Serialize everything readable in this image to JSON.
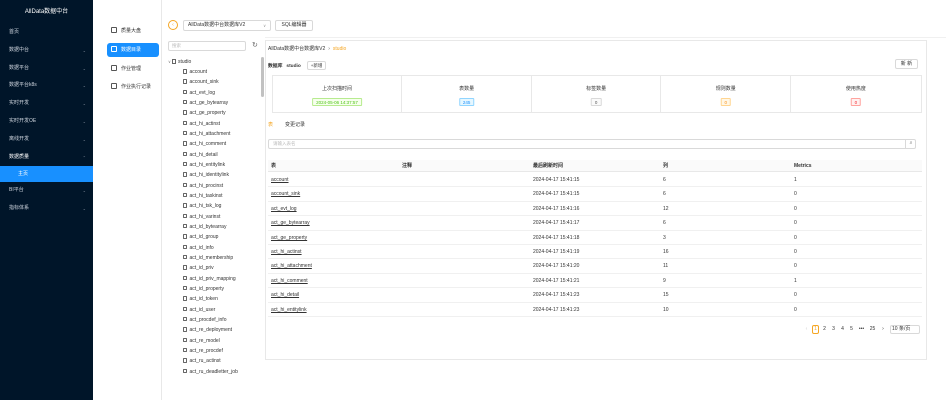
{
  "app": {
    "title": "AllData数据中台"
  },
  "sidebar": {
    "items": [
      {
        "label": "首页",
        "chevron": ""
      },
      {
        "label": "数据中台",
        "chevron": "⌄"
      },
      {
        "label": "数据平台",
        "chevron": "⌄"
      },
      {
        "label": "数据平台k8s",
        "chevron": "⌄"
      },
      {
        "label": "实时开发",
        "chevron": "⌄"
      },
      {
        "label": "实时开发OE",
        "chevron": "⌄"
      },
      {
        "label": "离线开发",
        "chevron": "⌄"
      },
      {
        "label": "数据质量",
        "chevron": "⌃"
      }
    ],
    "sub_item": "主页",
    "items_after": [
      {
        "label": "BI平台",
        "chevron": "⌄"
      },
      {
        "label": "指标体系",
        "chevron": "⌄"
      }
    ]
  },
  "menu2": {
    "items": [
      {
        "label": "质量大盘",
        "icon": "bar-chart-icon"
      },
      {
        "label": "数据目录",
        "icon": "catalog-icon"
      },
      {
        "label": "作业管理",
        "icon": "list-icon"
      },
      {
        "label": "作业执行记录",
        "icon": "record-icon"
      }
    ]
  },
  "tree": {
    "search_placeholder": "搜索",
    "root": "studio",
    "nodes": [
      "account",
      "account_sink",
      "act_evt_log",
      "act_ge_bytearray",
      "act_ge_property",
      "act_hi_actinst",
      "act_hi_attachment",
      "act_hi_comment",
      "act_hi_detail",
      "act_hi_entitylink",
      "act_hi_identitylink",
      "act_hi_procinst",
      "act_hi_taskinst",
      "act_hi_tsk_log",
      "act_hi_varinst",
      "act_id_bytearray",
      "act_id_group",
      "act_id_info",
      "act_id_membership",
      "act_id_priv",
      "act_id_priv_mapping",
      "act_id_property",
      "act_id_token",
      "act_id_user",
      "act_procdef_info",
      "act_re_deployment",
      "act_re_model",
      "act_re_procdef",
      "act_ru_actinst",
      "act_ru_deadletter_job"
    ]
  },
  "toolbar": {
    "back_icon": "‹",
    "db_select_value": "AllData数据中台数据库V2",
    "sql_editor_label": "SQL编辑器"
  },
  "breadcrumb": {
    "db": "AllData数据中台数据库V2",
    "current": "studio"
  },
  "dbline": {
    "label": "数据库",
    "value": "studio",
    "add_label": "+新增"
  },
  "new_button": "新 新",
  "stats": [
    {
      "title": "上次扫描时间",
      "value": "2024-05-06 14:37:57",
      "color": "green"
    },
    {
      "title": "表数量",
      "value": "245",
      "color": "blue"
    },
    {
      "title": "标签数量",
      "value": "0",
      "color": "grey"
    },
    {
      "title": "规则数量",
      "value": "0",
      "color": "orange"
    },
    {
      "title": "使用热度",
      "value": "0",
      "color": "red"
    }
  ],
  "tabs": {
    "tab1": "表",
    "tab2": "变更记录"
  },
  "table_search": {
    "placeholder": "请输入表名"
  },
  "table": {
    "columns": [
      "表",
      "注释",
      "最后刷新时间",
      "列",
      "Metrics"
    ],
    "rows": [
      {
        "name": "account",
        "comment": "",
        "time": "2024-04-17 15:41:15",
        "cols": "6",
        "metrics": "1"
      },
      {
        "name": "account_sink",
        "comment": "",
        "time": "2024-04-17 15:41:15",
        "cols": "6",
        "metrics": "0"
      },
      {
        "name": "act_evt_log",
        "comment": "",
        "time": "2024-04-17 15:41:16",
        "cols": "12",
        "metrics": "0"
      },
      {
        "name": "act_ge_bytearray",
        "comment": "",
        "time": "2024-04-17 15:41:17",
        "cols": "6",
        "metrics": "0"
      },
      {
        "name": "act_ge_property",
        "comment": "",
        "time": "2024-04-17 15:41:18",
        "cols": "3",
        "metrics": "0"
      },
      {
        "name": "act_hi_actinst",
        "comment": "",
        "time": "2024-04-17 15:41:19",
        "cols": "16",
        "metrics": "0"
      },
      {
        "name": "act_hi_attachment",
        "comment": "",
        "time": "2024-04-17 15:41:20",
        "cols": "11",
        "metrics": "0"
      },
      {
        "name": "act_hi_comment",
        "comment": "",
        "time": "2024-04-17 15:41:21",
        "cols": "9",
        "metrics": "1"
      },
      {
        "name": "act_hi_detail",
        "comment": "",
        "time": "2024-04-17 15:41:23",
        "cols": "15",
        "metrics": "0"
      },
      {
        "name": "act_hi_entitylink",
        "comment": "",
        "time": "2024-04-17 15:41:23",
        "cols": "10",
        "metrics": "0"
      }
    ]
  },
  "pagination": {
    "prev": "‹",
    "current": "1",
    "pages": [
      "2",
      "3",
      "4",
      "5"
    ],
    "ellipsis": "•••",
    "last": "25",
    "next": "›",
    "page_size": "10 条/页"
  }
}
